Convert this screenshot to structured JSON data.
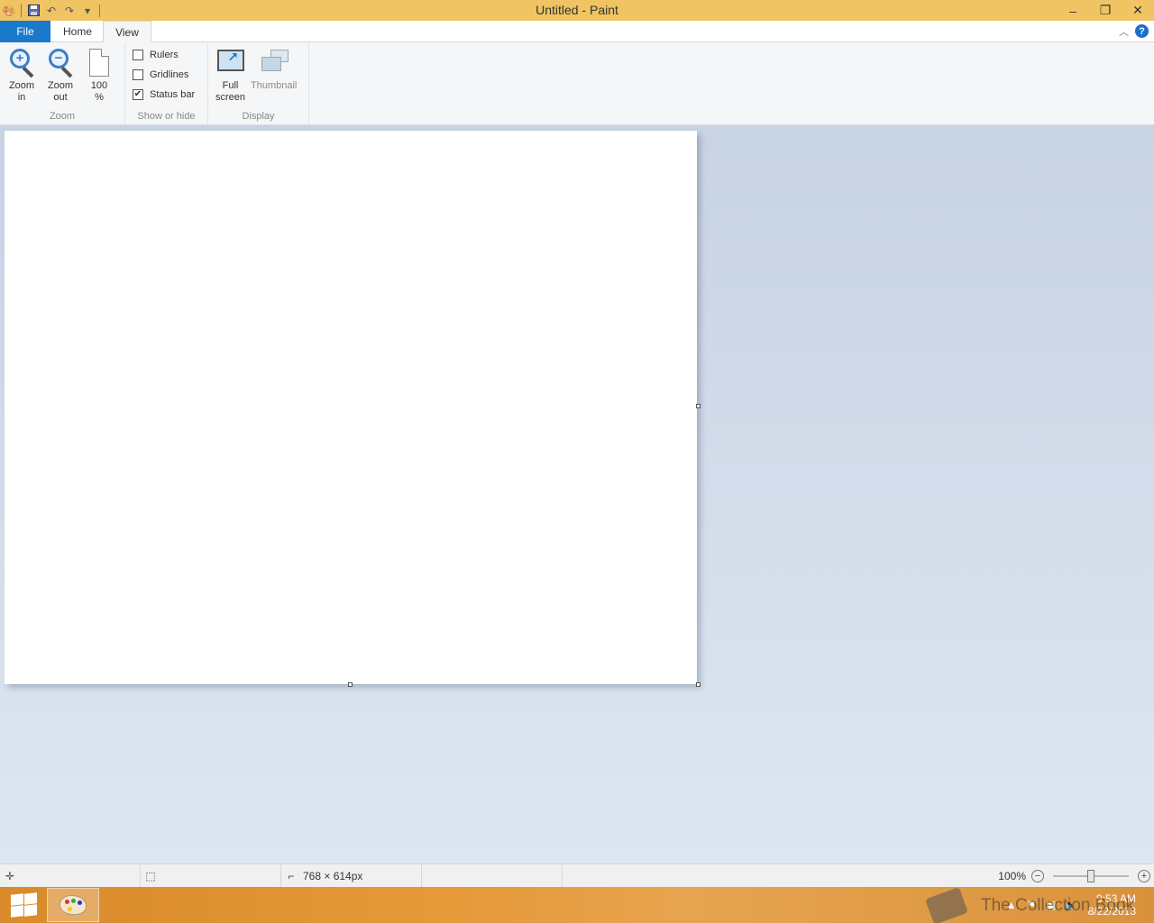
{
  "window": {
    "title": "Untitled - Paint",
    "controls": {
      "minimize": "–",
      "restore": "❐",
      "close": "✕"
    }
  },
  "qat": {
    "items": [
      "paint-menu-icon",
      "save-icon",
      "undo-icon",
      "redo-icon",
      "customize-icon"
    ]
  },
  "tabs": {
    "file": "File",
    "home": "Home",
    "view": "View"
  },
  "ribbon": {
    "zoom": {
      "label": "Zoom",
      "zoom_in": [
        "Zoom",
        "in"
      ],
      "zoom_out": [
        "Zoom",
        "out"
      ],
      "hundred": [
        "100",
        "%"
      ]
    },
    "show_hide": {
      "label": "Show or hide",
      "rulers": "Rulers",
      "gridlines": "Gridlines",
      "status_bar": "Status bar",
      "checked": {
        "rulers": false,
        "gridlines": false,
        "status_bar": true
      }
    },
    "display": {
      "label": "Display",
      "full_screen": [
        "Full",
        "screen"
      ],
      "thumbnail": "Thumbnail"
    }
  },
  "statusbar": {
    "canvas_size": "768 × 614px",
    "zoom_level": "100%",
    "zoom_fraction": 0.5
  },
  "taskbar": {
    "time": "9:53 AM",
    "date": "8/22/2013",
    "watermark": "The Collection Book"
  },
  "colors": {
    "titlebar": "#f0c463",
    "file_tab": "#1979ca",
    "workspace": "#dde6f1",
    "taskbar": "#e69a3a"
  }
}
